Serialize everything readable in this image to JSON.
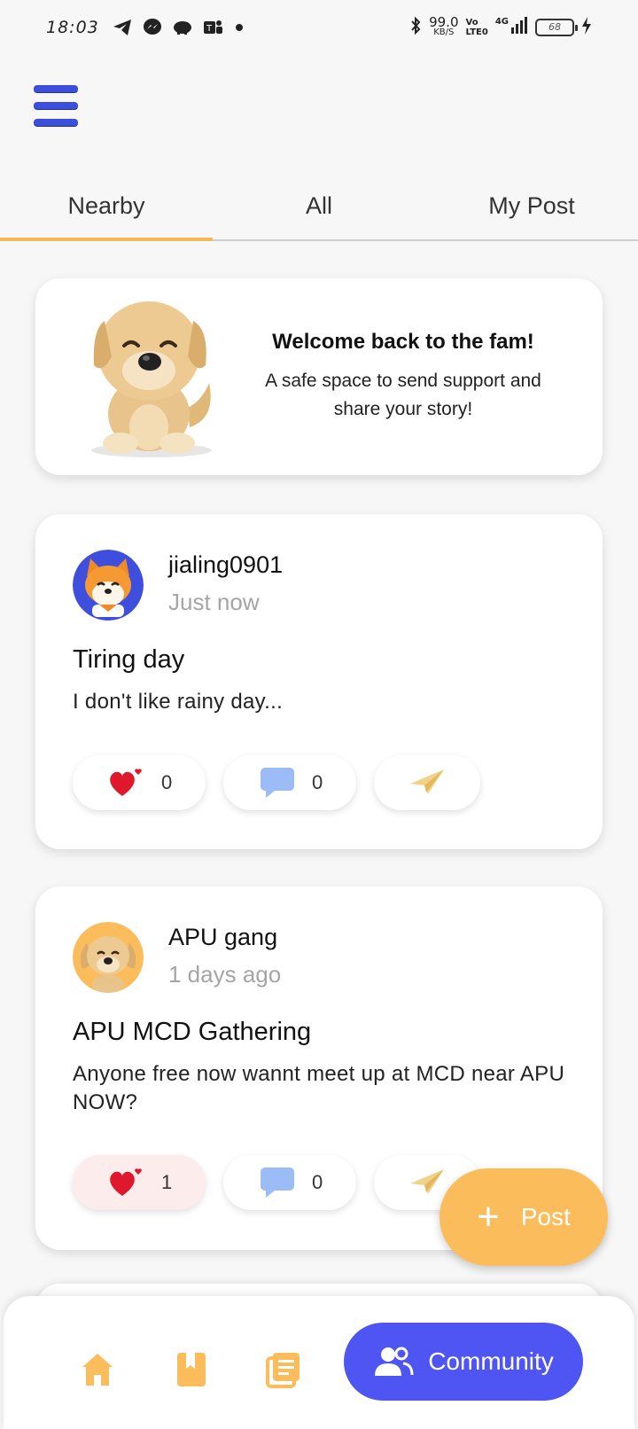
{
  "status_bar": {
    "time": "18:03",
    "net_speed_value": "99.0",
    "net_speed_unit": "KB/S",
    "volte_top": "Vo",
    "volte_bottom": "LTE0",
    "network": "4G",
    "battery": "68",
    "notification_icons": [
      "telegram-icon",
      "messenger-icon",
      "piggy-bank-icon",
      "teams-icon",
      "dot-icon"
    ]
  },
  "tabs": [
    {
      "label": "Nearby",
      "active": true
    },
    {
      "label": "All",
      "active": false
    },
    {
      "label": "My Post",
      "active": false
    }
  ],
  "welcome": {
    "title": "Welcome back to the fam!",
    "subtitle": "A safe space to send support and share your story!"
  },
  "posts": [
    {
      "username": "jialing0901",
      "time": "Just now",
      "title": "Tiring day",
      "body": "I don't like rainy day...",
      "likes": "0",
      "comments": "0",
      "liked": false,
      "avatar_bg": "#3d4fdc"
    },
    {
      "username": "APU gang",
      "time": "1 days ago",
      "title": "APU MCD Gathering",
      "body": "Anyone free now wannt meet up at MCD near APU NOW?",
      "likes": "1",
      "comments": "0",
      "liked": true,
      "avatar_bg": "#fbbd5c"
    }
  ],
  "fab": {
    "label": "Post"
  },
  "bottom_nav": {
    "items": [
      {
        "icon": "home-icon"
      },
      {
        "icon": "bookmark-book-icon"
      },
      {
        "icon": "journal-icon"
      }
    ],
    "active_label": "Community"
  },
  "colors": {
    "accent": "#f7b955",
    "primary": "#4e55f2",
    "hamburger": "#3c4fdc"
  }
}
